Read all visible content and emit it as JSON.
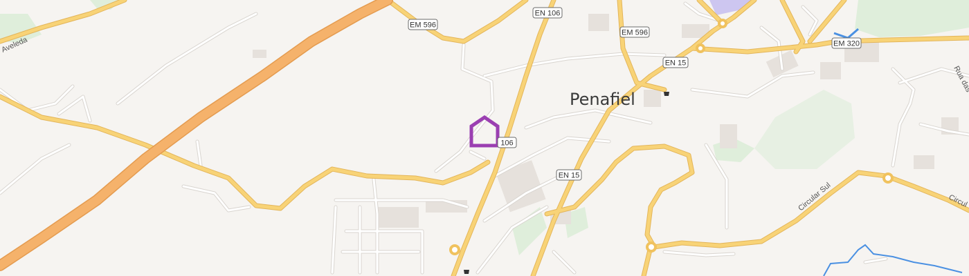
{
  "map": {
    "place_label": "Penafiel",
    "colors": {
      "background": "#f6f4f1",
      "motorway": "#f5b26b",
      "primary_road": "#f8d377",
      "minor_road": "#ffffff",
      "road_casing": "#d9d5d0",
      "park": "#dfeedb",
      "building": "#e6e1dc",
      "water": "#4a90e2",
      "marker": "#9b3fb1",
      "special_area": "#cdc6f0"
    },
    "route_shields": [
      {
        "label": "EM 596"
      },
      {
        "label": "EM 596"
      },
      {
        "label": "EN 106"
      },
      {
        "label": "EN 15"
      },
      {
        "label": "106"
      },
      {
        "label": "EN 15"
      },
      {
        "label": "EM 320"
      }
    ],
    "street_labels": [
      {
        "text": "Aveleda"
      },
      {
        "text": "Circular Sul"
      },
      {
        "text": "Circul"
      },
      {
        "text": "Rua das"
      }
    ],
    "marker": {
      "icon": "home-outline-icon"
    },
    "icons": [
      {
        "name": "shopping-cart-icon"
      },
      {
        "name": "shopping-cart-icon"
      }
    ]
  }
}
